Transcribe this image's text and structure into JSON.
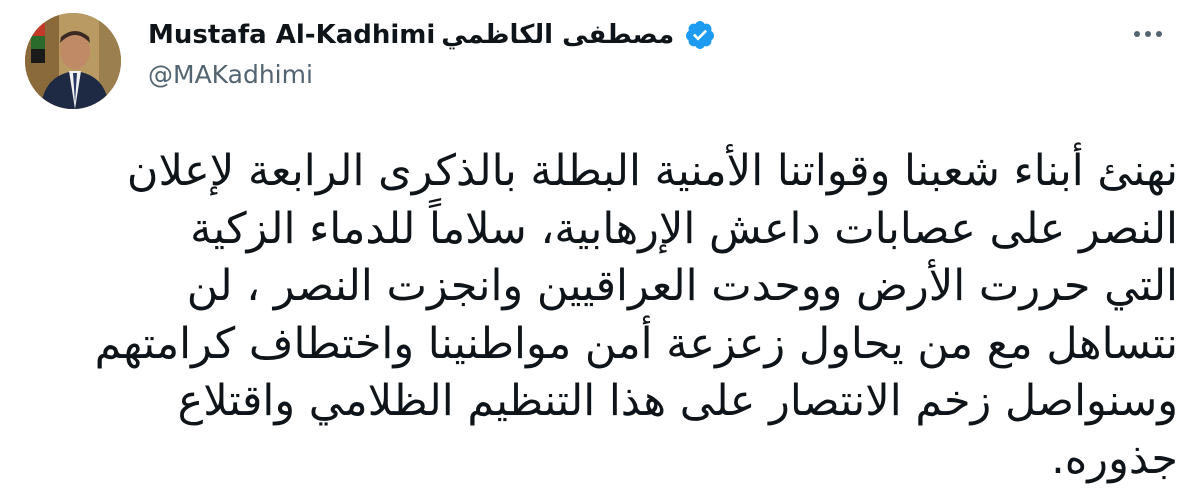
{
  "author": {
    "name_latin": "Mustafa Al-Kadhimi",
    "name_arabic": "مصطفى الكاظمي",
    "handle": "@MAKadhimi",
    "verified": true,
    "avatar_icon": "profile-photo",
    "verified_icon": "verified-badge-icon"
  },
  "menu": {
    "icon": "more-options-icon",
    "glyph": "⋯"
  },
  "tweet": {
    "lines": [
      "نهنئ أبناء شعبنا وقواتنا الأمنية البطلة بالذكرى الرابعة لإعلان",
      "النصر على عصابات داعش الإرهابية، سلاماً للدماء الزكية",
      "التي حررت الأرض ووحدت العراقيين وانجزت النصر ، لن",
      "نتساهل مع من يحاول زعزعة أمن مواطنينا واختطاف كرامتهم",
      "وسنواصل زخم الانتصار على هذا التنظيم الظلامي واقتلاع",
      "جذوره."
    ]
  },
  "colors": {
    "text": "#0f1419",
    "secondary": "#536471",
    "verified": "#1d9bf0",
    "background": "#ffffff"
  }
}
